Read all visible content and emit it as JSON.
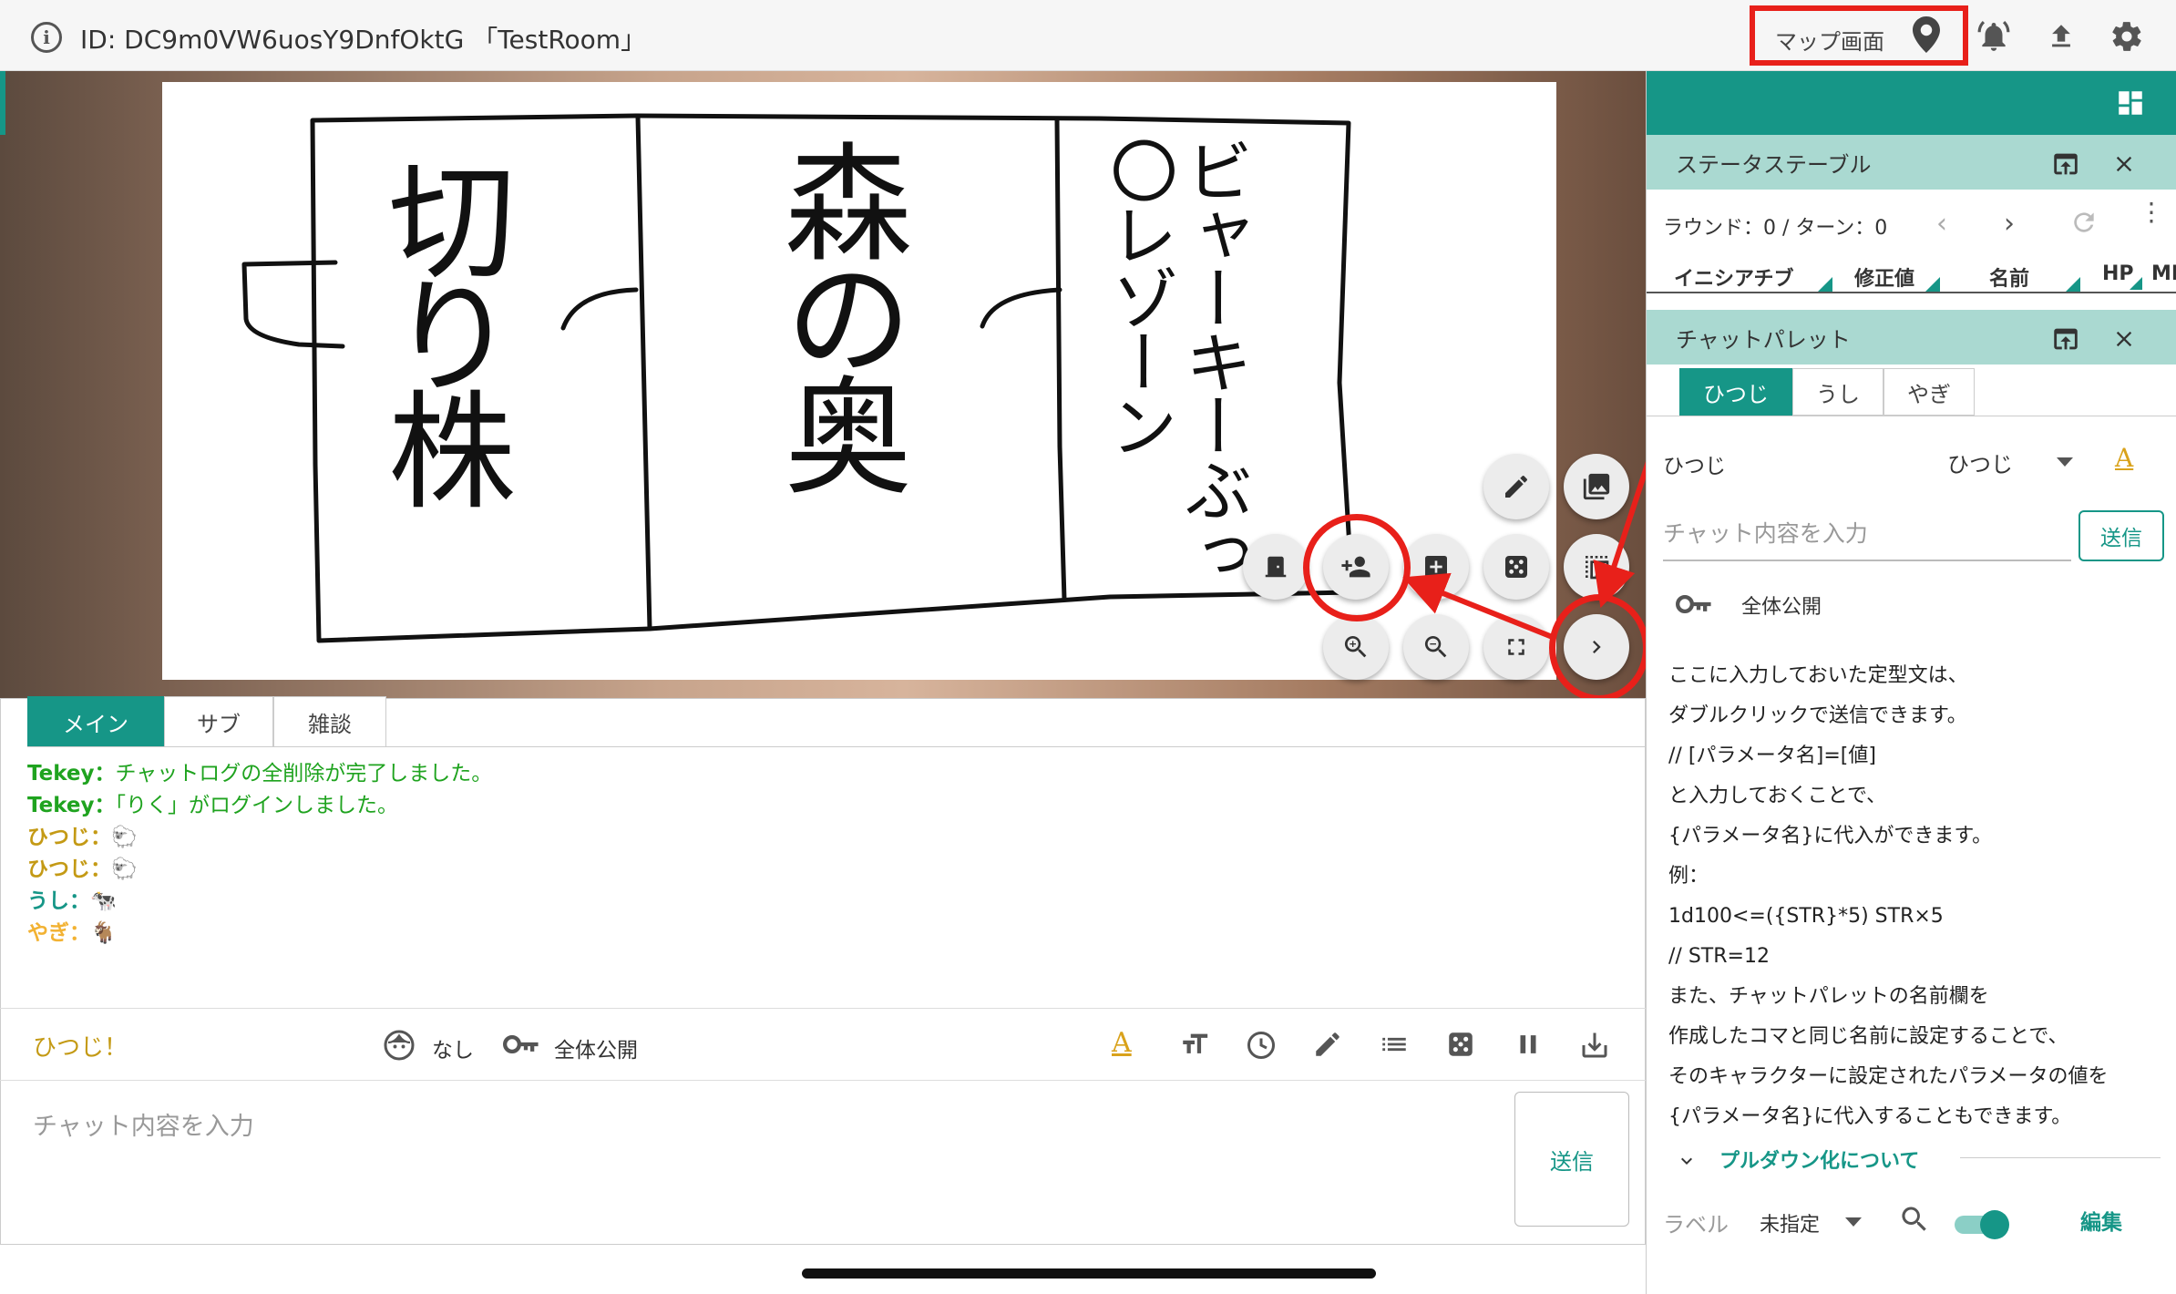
{
  "topbar": {
    "room_id": "ID: DC9m0VW6uosY9DnfOktG 「TestRoom」",
    "map_label": "マップ画面",
    "icons": [
      "info-icon",
      "map-pin-icon",
      "bell-icon",
      "upload-icon",
      "gear-icon"
    ]
  },
  "board": {
    "sections": [
      "切り株",
      "森の奥",
      "ビャーキーぶっ〇レゾーン"
    ]
  },
  "fab": {
    "icons": [
      "pencil-icon",
      "image-icon",
      "door-icon",
      "add-person-icon",
      "add-box-icon",
      "dice-icon",
      "select-icon",
      "zoom-in-icon",
      "zoom-out-icon",
      "fullscreen-icon",
      "chevron-right-icon"
    ]
  },
  "chat": {
    "tabs": [
      "メイン",
      "サブ",
      "雑談"
    ],
    "log": [
      {
        "name": "Tekey",
        "text": "チャットログの全削除が完了しました。",
        "color": "#1fa31f"
      },
      {
        "name": "Tekey",
        "text": "「りく」がログインしました。",
        "color": "#1fa31f"
      },
      {
        "name": "ひつじ",
        "text": "🐑",
        "color": "#c49a15"
      },
      {
        "name": "ひつじ",
        "text": "🐑",
        "color": "#c49a15"
      },
      {
        "name": "うし",
        "text": "🐄",
        "color": "#169687"
      },
      {
        "name": "やぎ",
        "text": "🐐",
        "color": "#f2b233"
      }
    ],
    "separator": "：",
    "speaker": "ひつじ！",
    "face_label": "なし",
    "visibility_label": "全体公開",
    "input_placeholder": "チャット内容を入力",
    "send_label": "送信"
  },
  "sidebar": {
    "status_table": {
      "title": "ステータステーブル",
      "round_text": "ラウンド：0 / ターン：0",
      "columns": [
        "イニシアチブ",
        "修正値",
        "名前",
        "HP",
        "MP"
      ]
    },
    "chat_palette": {
      "title": "チャットパレット",
      "tabs": [
        "ひつじ",
        "うし",
        "やぎ"
      ],
      "name_label": "ひつじ",
      "name_select": "ひつじ",
      "input_placeholder": "チャット内容を入力",
      "send_label": "送信",
      "visibility_label": "全体公開",
      "lines": [
        "ここに入力しておいた定型文は、",
        "ダブルクリックで送信できます。",
        "// [パラメータ名]=[値]",
        "と入力しておくことで、",
        "{パラメータ名}に代入ができます。",
        "例：",
        "1d100<=({STR}*5) STR×5",
        "// STR=12",
        "また、チャットパレットの名前欄を",
        "作成したコマと同じ名前に設定することで、",
        "そのキャラクターに設定されたパラメータの値を",
        "{パラメータ名}に代入することもできます。"
      ],
      "pulldown_label": "プルダウン化について",
      "label_text": "ラベル",
      "label_select": "未指定",
      "edit_label": "編集"
    }
  },
  "colors": {
    "accent": "#169687",
    "highlight": "#e8201a",
    "panel_header": "#aad9d1"
  }
}
